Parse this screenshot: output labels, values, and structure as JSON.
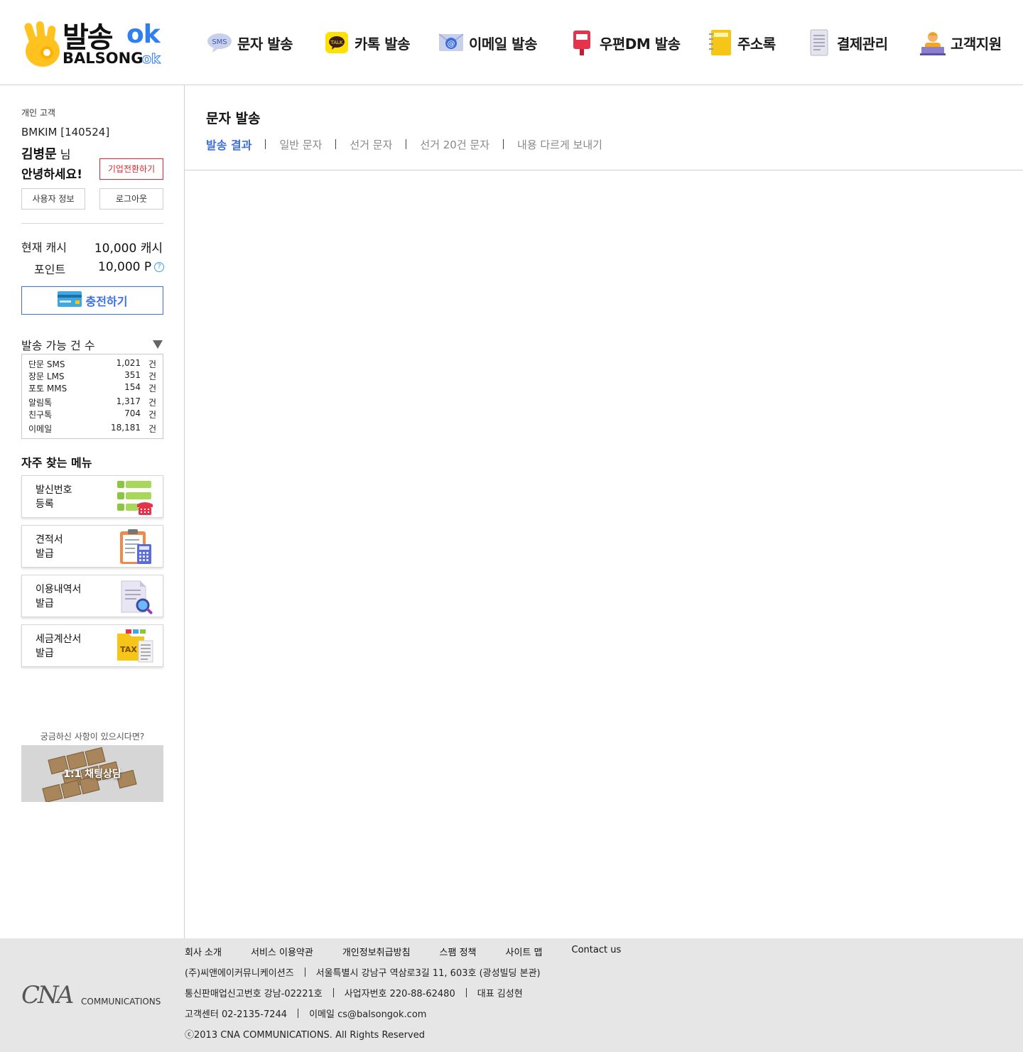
{
  "brand": {
    "name_ko": "발송",
    "name_ok": "ok",
    "name_en": "BALSONG",
    "name_en_ok": "ok",
    "accent": "#2f7ef2"
  },
  "nav": [
    {
      "label": "문자 발송",
      "icon": "sms-bubble-icon",
      "badge": "SMS"
    },
    {
      "label": "카톡 발송",
      "icon": "kakaotalk-icon",
      "badge": "TALK"
    },
    {
      "label": "이메일 발송",
      "icon": "email-envelope-icon",
      "badge": "@"
    },
    {
      "label": "우편DM 발송",
      "icon": "postbox-icon"
    },
    {
      "label": "주소록",
      "icon": "address-book-icon"
    },
    {
      "label": "결제관리",
      "icon": "receipt-icon"
    },
    {
      "label": "고객지원",
      "icon": "support-agent-icon"
    }
  ],
  "user": {
    "type": "개인 고객",
    "id": "BMKIM",
    "number": "[140524]",
    "name": "김병문",
    "suffix": "님",
    "greeting": "안녕하세요!",
    "convert_label": "기업전환하기",
    "info_label": "사용자 정보",
    "logout_label": "로그아웃"
  },
  "balance": {
    "cash_label": "현재 캐시",
    "cash_value": "10,000",
    "cash_unit": "캐시",
    "point_label": "포인트",
    "point_value": "10,000",
    "point_unit": "P",
    "charge_label": "충전하기"
  },
  "counts": {
    "title": "발송 가능 건 수",
    "unit": "건",
    "rows": [
      {
        "name": "단문 SMS",
        "value": "1,021"
      },
      {
        "name": "장문 LMS",
        "value": "351"
      },
      {
        "name": "포토 MMS",
        "value": "154"
      },
      {
        "name": "알림톡",
        "value": "1,317"
      },
      {
        "name": "친구톡",
        "value": "704"
      },
      {
        "name": "이메일",
        "value": "18,181"
      }
    ]
  },
  "favorites": {
    "title": "자주 찾는 메뉴",
    "items": [
      {
        "line1": "발신번호",
        "line2": "등록",
        "icon": "phone-list-icon"
      },
      {
        "line1": "견적서",
        "line2": "발급",
        "icon": "clipboard-calculator-icon"
      },
      {
        "line1": "이용내역서",
        "line2": "발급",
        "icon": "document-search-icon"
      },
      {
        "line1": "세금계산서",
        "line2": "발급",
        "icon": "tax-folder-icon",
        "badge": "TAX"
      }
    ]
  },
  "help": {
    "question": "궁금하신 사항이 있으시다면?",
    "banner_label": "1:1 채팅상담"
  },
  "main": {
    "title": "문자 발송",
    "tabs": [
      "발송 결과",
      "일반 문자",
      "선거 문자",
      "선거 20건 문자",
      "내용 다르게 보내기"
    ],
    "active_tab": 0,
    "accent": "#3d6fe0"
  },
  "footer": {
    "logo_cna": "CNA",
    "logo_sub": "COMMUNICATIONS",
    "links": [
      "회사 소개",
      "서비스 이용약관",
      "개인정보취급방침",
      "스팸 정책",
      "사이트 맵",
      "Contact us"
    ],
    "company": "(주)씨앤에이커뮤니케이션즈",
    "address": "서울특별시 강남구 역삼로3길 11, 603호 (광성빌딩 본관)",
    "mail_order": "통신판매업신고번호 강남-02221호",
    "biz_no": "사업자번호 220-88-62480",
    "ceo": "대표 김성현",
    "tel": "고객센터 02-2135-7244",
    "email": "이메일 cs@balsongok.com",
    "copyright": "ⓒ2013 CNA COMMUNICATIONS. All Rights Reserved"
  }
}
